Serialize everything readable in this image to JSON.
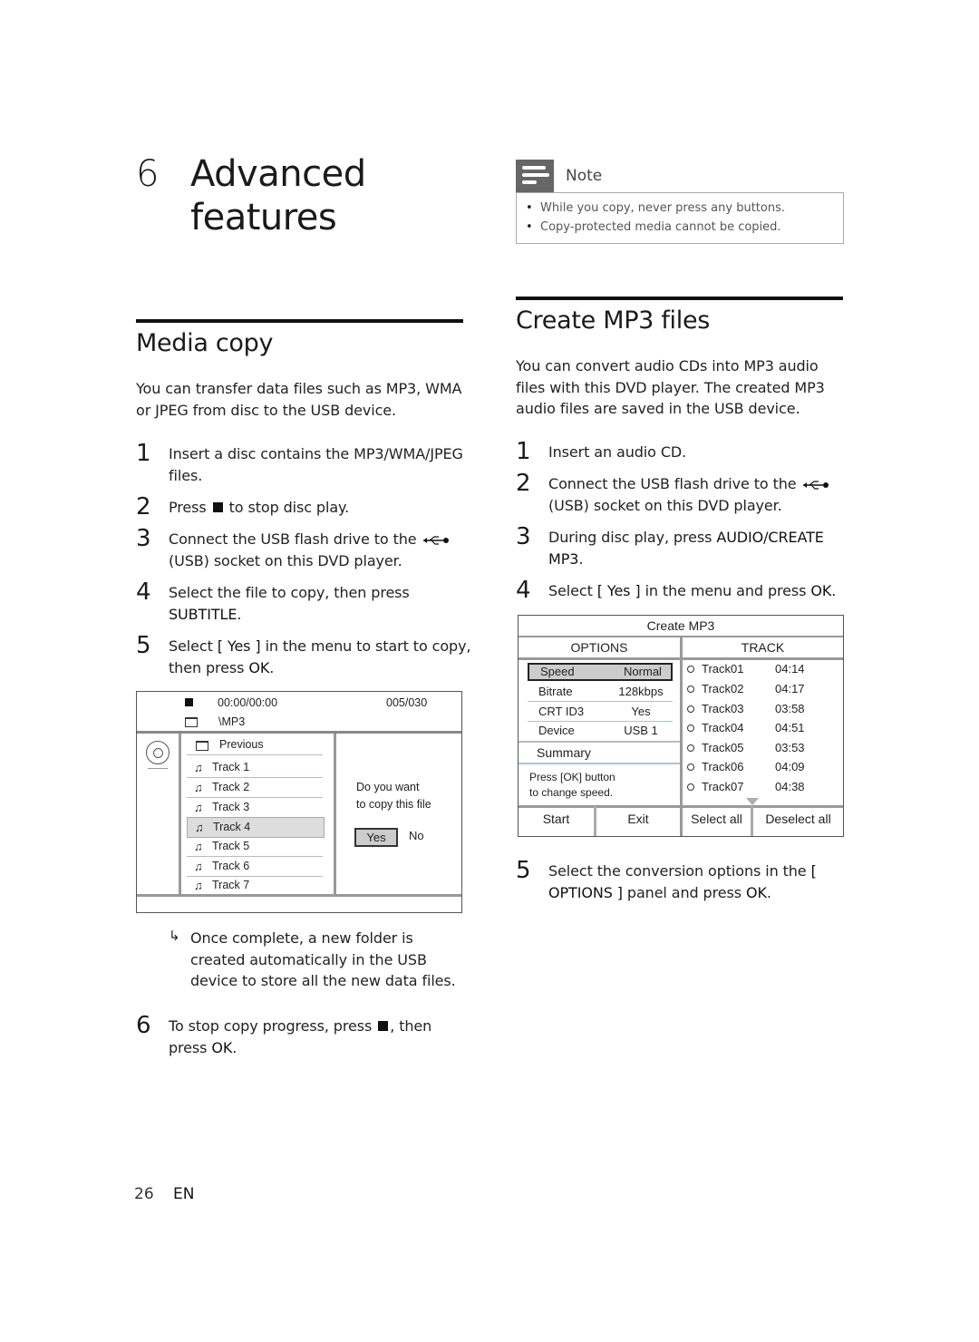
{
  "chapter": {
    "number": "6",
    "title_line1": "Advanced",
    "title_line2": "features"
  },
  "note": {
    "label": "Note",
    "icon": "note-icon",
    "items": [
      "While you copy, never press any buttons.",
      "Copy-protected media cannot be copied."
    ]
  },
  "media_copy": {
    "heading": "Media copy",
    "intro": "You can transfer data files such as MP3, WMA or JPEG from disc to the USB device.",
    "steps": [
      {
        "n": "1",
        "text": "Insert a disc contains the MP3/WMA/JPEG files."
      },
      {
        "n": "2",
        "pre": "Press",
        "post": "to stop disc play."
      },
      {
        "n": "3",
        "pre": "Connect the USB flash drive to the",
        "post": "(USB) socket on this DVD player."
      },
      {
        "n": "4",
        "pre": "Select the file to copy, then press",
        "kw": "SUBTITLE",
        "post": "."
      },
      {
        "n": "5",
        "pre": "Select",
        "kw": "[ Yes ]",
        "mid": "in the menu to start to copy, then press",
        "kw2": "OK",
        "post": "."
      }
    ],
    "result": "Once complete, a new folder is created automatically in the USB device to store all the new data files.",
    "step6": {
      "n": "6",
      "pre": "To stop copy progress, press",
      "mid": ", then press",
      "kw": "OK",
      "post": "."
    },
    "screen": {
      "time": "00:00/00:00",
      "count": "005/030",
      "folder": "\\MP3",
      "previous": "Previous",
      "tracks": [
        "Track 1",
        "Track 2",
        "Track 3",
        "Track 4",
        "Track 5",
        "Track 6",
        "Track 7"
      ],
      "selected_track": "Track 4",
      "prompt_line1": "Do you want",
      "prompt_line2": "to copy this file",
      "yes": "Yes",
      "no": "No"
    }
  },
  "create_mp3": {
    "heading": "Create MP3 files",
    "intro": "You can convert audio CDs into MP3 audio files with this DVD player. The created MP3 audio files are saved in the USB device.",
    "steps": [
      {
        "n": "1",
        "text": "Insert an audio CD."
      },
      {
        "n": "2",
        "pre": "Connect the USB flash drive to the",
        "post": "(USB) socket on this DVD player."
      },
      {
        "n": "3",
        "pre": "During disc play, press",
        "kw": "AUDIO/CREATE MP3",
        "post": "."
      },
      {
        "n": "4",
        "pre": "Select",
        "kw": "[ Yes ]",
        "mid": "in the menu and press",
        "kw2": "OK",
        "post": "."
      },
      {
        "n": "5",
        "pre": "Select the conversion options in the",
        "kw": "[ OPTIONS ]",
        "mid": "panel and press",
        "kw2": "OK",
        "post": "."
      }
    ],
    "screen": {
      "title": "Create MP3",
      "options_header": "OPTIONS",
      "track_header": "TRACK",
      "options": [
        {
          "key": "Speed",
          "value": "Normal"
        },
        {
          "key": "Bitrate",
          "value": "128kbps"
        },
        {
          "key": "CRT ID3",
          "value": "Yes"
        },
        {
          "key": "Device",
          "value": "USB 1"
        }
      ],
      "summary": "Summary",
      "help_line1": "Press [OK] button",
      "help_line2": "to change speed.",
      "tracks": [
        {
          "name": "Track01",
          "time": "04:14"
        },
        {
          "name": "Track02",
          "time": "04:17"
        },
        {
          "name": "Track03",
          "time": "03:58"
        },
        {
          "name": "Track04",
          "time": "04:51"
        },
        {
          "name": "Track05",
          "time": "03:53"
        },
        {
          "name": "Track06",
          "time": "04:09"
        },
        {
          "name": "Track07",
          "time": "04:38"
        }
      ],
      "buttons": [
        "Start",
        "Exit",
        "Select all",
        "Deselect all"
      ]
    }
  },
  "footer": {
    "page": "26",
    "lang": "EN"
  }
}
